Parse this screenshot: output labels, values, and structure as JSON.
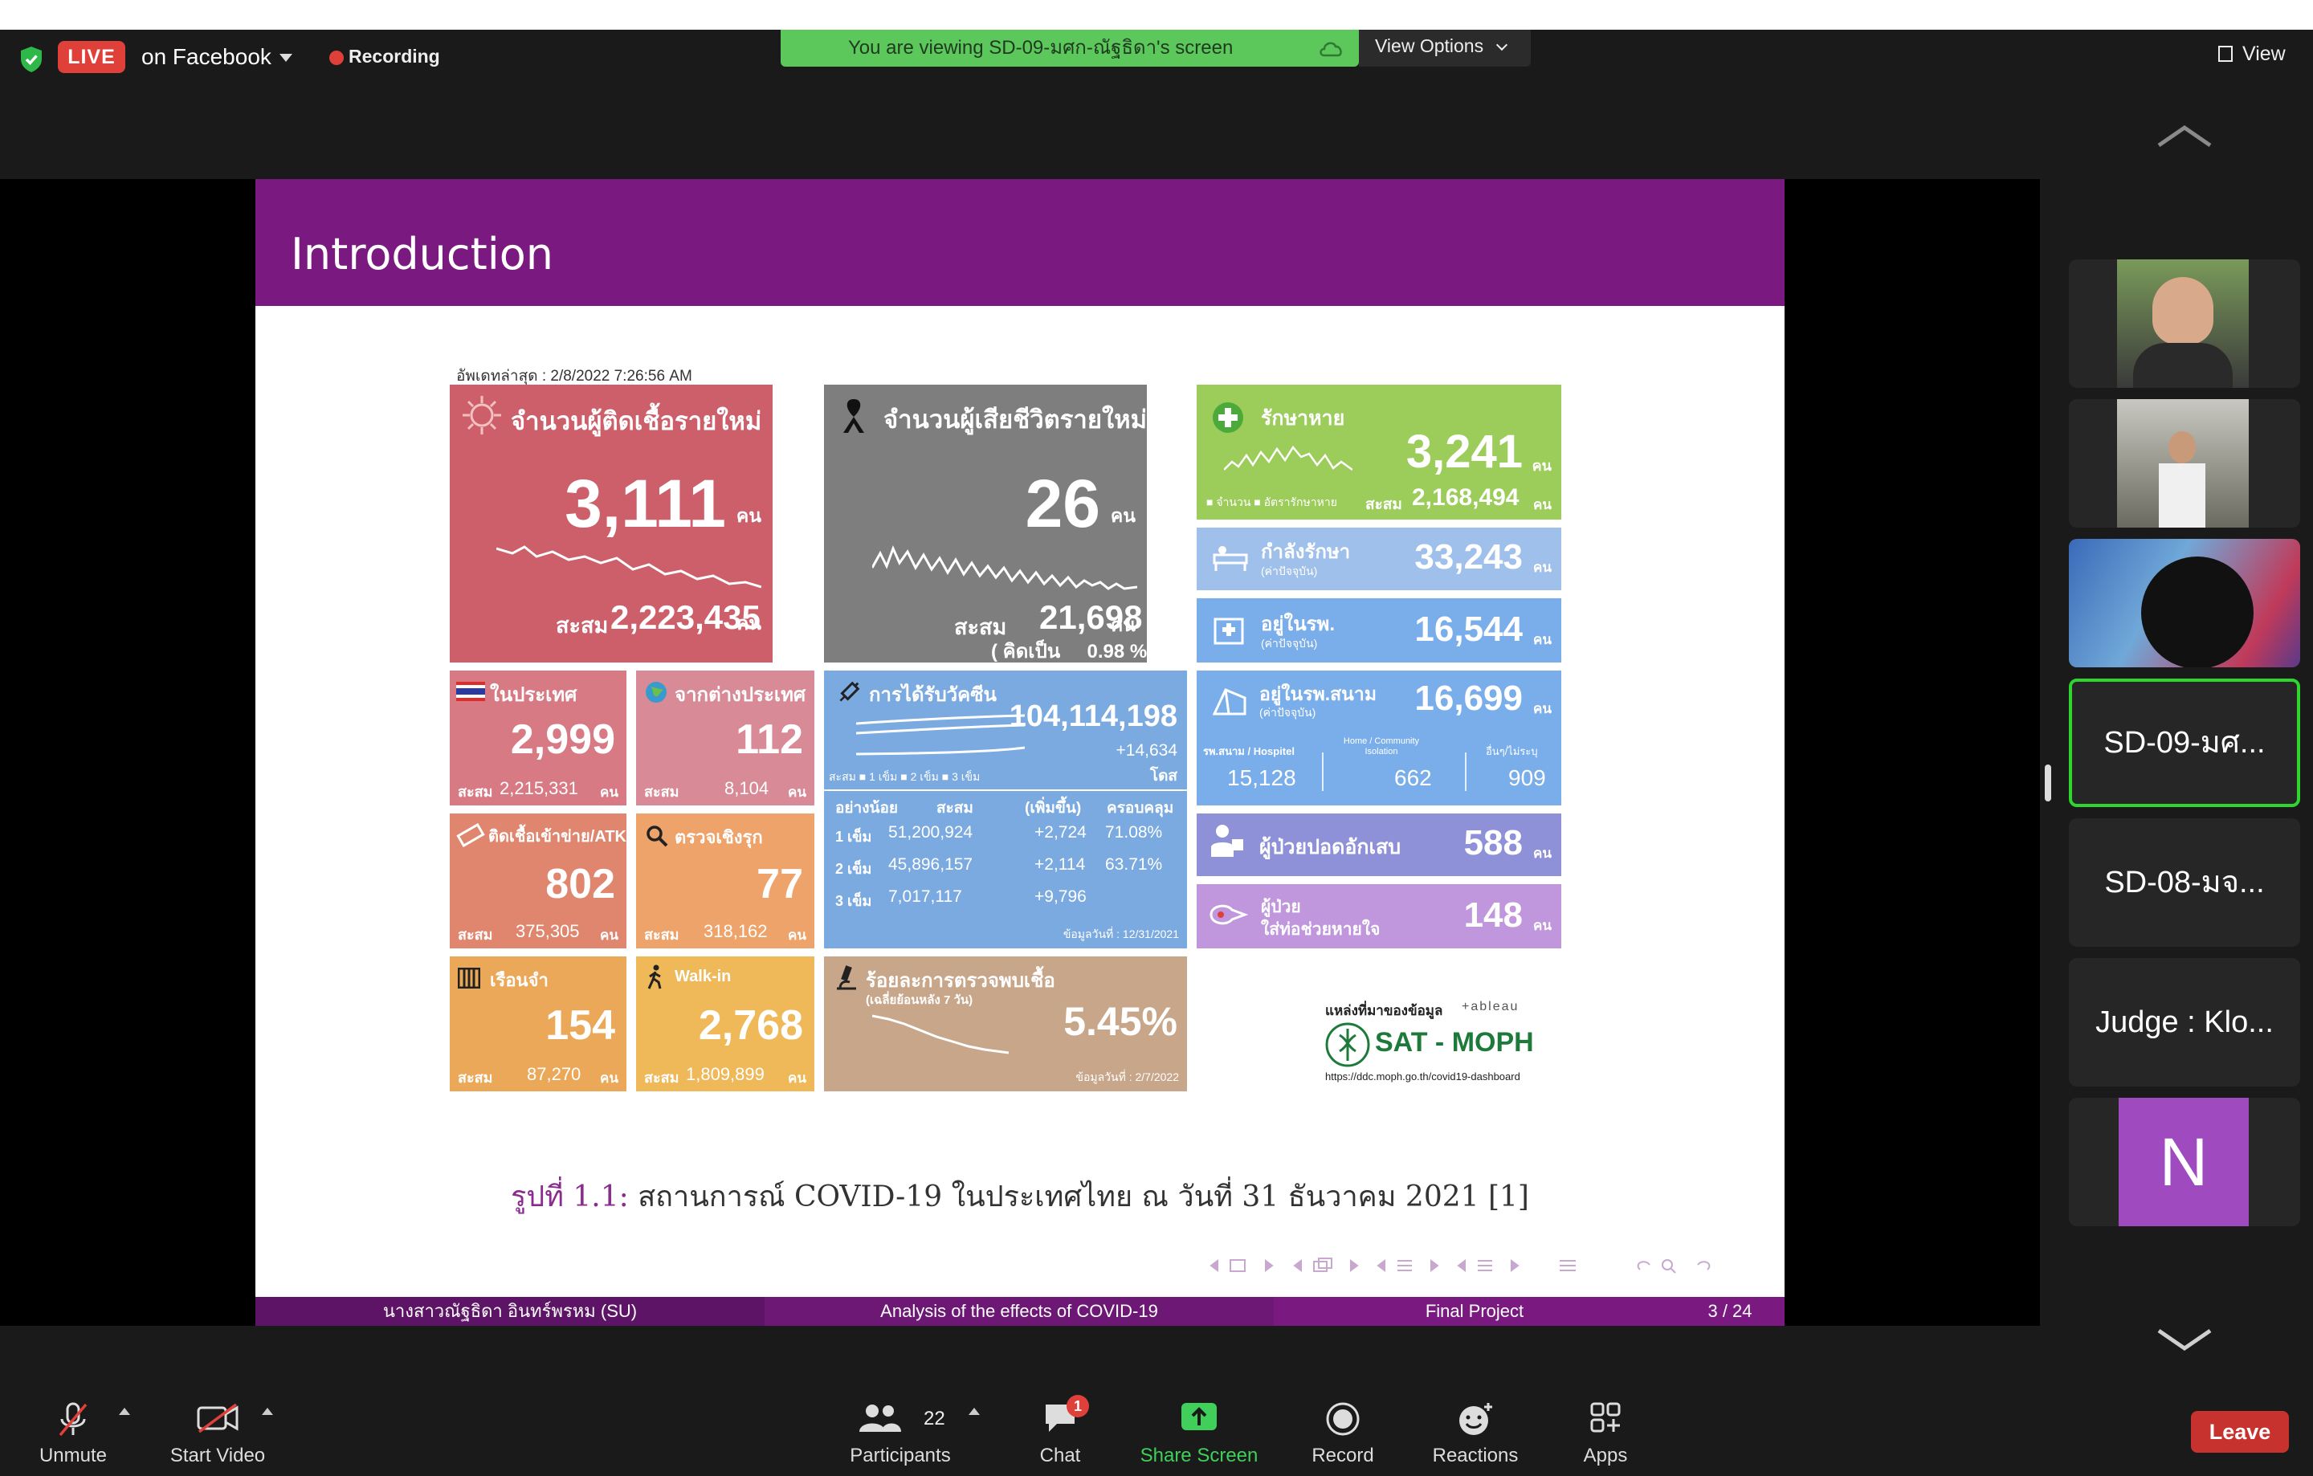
{
  "topbar": {
    "live_badge": "LIVE",
    "live_destination": "on Facebook",
    "recording": "Recording",
    "viewing_banner": "You are viewing SD-09-มศก-ณัฐธิดา's screen",
    "view_options": "View Options",
    "view": "View"
  },
  "slide": {
    "title": "Introduction",
    "caption_prefix": "รูปที่ 1.1:",
    "caption_text": " สถานการณ์ COVID-19 ในประเทศไทย ณ วันที่ 31 ธันวาคม 2021 [1]",
    "footer": {
      "author": "นางสาวณัฐธิดา อินทร์พรหม  (SU)",
      "topic": "Analysis of the effects of COVID-19",
      "project": "Final Project",
      "page": "3 / 24"
    }
  },
  "dashboard": {
    "updated": "อัพเดทล่าสุด : 2/8/2022 7:26:56 AM",
    "new_cases": {
      "label": "จำนวนผู้ติดเชื้อรายใหม่",
      "value": "3,111",
      "unit": "คน",
      "total_label": "สะสม",
      "total": "2,223,435",
      "total_unit": "คน"
    },
    "new_deaths": {
      "label": "จำนวนผู้เสียชีวิตรายใหม่",
      "value": "26",
      "unit": "คน",
      "total_label": "สะสม",
      "total": "21,698",
      "total_unit": "คน",
      "pct": "( คิดเป็น     0.98 % )"
    },
    "recovered": {
      "label": "รักษาหาย",
      "value": "3,241",
      "unit": "คน",
      "legend": "■ จำนวน ■ อัตรารักษาหาย",
      "total_label": "สะสม",
      "total": "2,168,494",
      "total_unit": "คน"
    },
    "treating": {
      "label": "กำลังรักษา",
      "sub": "(ค่าปัจจุบัน)",
      "value": "33,243",
      "unit": "คน"
    },
    "hospital": {
      "label": "อยู่ในรพ.",
      "sub": "(ค่าปัจจุบัน)",
      "value": "16,544",
      "unit": "คน"
    },
    "domestic": {
      "label": "ในประเทศ",
      "value": "2,999",
      "total_label": "สะสม",
      "total": "2,215,331",
      "unit": "คน"
    },
    "abroad": {
      "label": "จากต่างประเทศ",
      "value": "112",
      "total_label": "สะสม",
      "total": "8,104",
      "unit": "คน"
    },
    "atk": {
      "label": "ติดเชื้อเข้าข่าย/ATK",
      "value": "802",
      "total_label": "สะสม",
      "total": "375,305",
      "unit": "คน"
    },
    "proactive": {
      "label": "ตรวจเชิงรุก",
      "value": "77",
      "total_label": "สะสม",
      "total": "318,162",
      "unit": "คน"
    },
    "prison": {
      "label": "เรือนจำ",
      "value": "154",
      "total_label": "สะสม",
      "total": "87,270",
      "unit": "คน"
    },
    "walkin": {
      "label": "Walk-in",
      "value": "2,768",
      "total_label": "สะสม",
      "total": "1,809,899",
      "unit": "คน"
    },
    "vaccine": {
      "label": "การได้รับวัคซีน",
      "value": "104,114,198",
      "delta": "+14,634",
      "unit": "โดส",
      "legend": "สะสม ■ 1 เข็ม ■ 2 เข็ม ■ 3 เข็ม",
      "headers": [
        "อย่างน้อย",
        "สะสม",
        "(เพิ่มขึ้น)",
        "ครอบคลุม"
      ],
      "rows": [
        [
          "1 เข็ม",
          "51,200,924",
          "+2,724",
          "71.08%"
        ],
        [
          "2 เข็ม",
          "45,896,157",
          "+2,114",
          "63.71%"
        ],
        [
          "3 เข็ม",
          "7,017,117",
          "+9,796",
          ""
        ]
      ],
      "asof": "ข้อมูลวันที่ : 12/31/2021"
    },
    "field_hosp": {
      "label": "อยู่ในรพ.สนาม",
      "sub": "(ค่าปัจจุบัน)",
      "value": "16,699",
      "unit": "คน",
      "cols": [
        "รพ.สนาม / Hospitel",
        "Home / Community Isolation",
        "อื่นๆ/ไม่ระบุ"
      ],
      "vals": [
        "15,128",
        "662",
        "909"
      ]
    },
    "pneumonia": {
      "label": "ผู้ป่วยปอดอักเสบ",
      "value": "588",
      "unit": "คน"
    },
    "ventilator": {
      "label1": "ผู้ป่วย",
      "label2": "ใส่ท่อช่วยหายใจ",
      "value": "148",
      "unit": "คน"
    },
    "positivity": {
      "label": "ร้อยละการตรวจพบเชื้อ",
      "sub": "(เฉลี่ยย้อนหลัง 7 วัน)",
      "value": "5.45%",
      "asof": "ข้อมูลวันที่ : 2/7/2022"
    },
    "source": {
      "heading": "แหล่งที่มาของข้อมูล",
      "tableau": "+ableau",
      "org": "SAT - MOPH",
      "url": "https://ddc.moph.go.th/covid19-dashboard"
    }
  },
  "gallery": [
    {
      "name": "",
      "type": "photo",
      "color": "#6a8a5a"
    },
    {
      "name": "",
      "type": "photo",
      "color": "#8a8a80"
    },
    {
      "name": "",
      "type": "photo",
      "color": "#4a7aa8"
    },
    {
      "name": "SD-09-มศ...",
      "type": "name"
    },
    {
      "name": "SD-08-มจ...",
      "type": "name"
    },
    {
      "name": "Judge : Klo...",
      "type": "name"
    },
    {
      "name": "N",
      "type": "avatar",
      "color": "#a04ac0"
    }
  ],
  "toolbar": {
    "unmute": "Unmute",
    "start_video": "Start Video",
    "participants": "Participants",
    "participants_count": "22",
    "chat": "Chat",
    "chat_badge": "1",
    "share_screen": "Share Screen",
    "record": "Record",
    "reactions": "Reactions",
    "apps": "Apps",
    "leave": "Leave"
  },
  "colors": {
    "live": "#e0403a",
    "banner": "#5cc85c",
    "slide_header": "#7a1a80",
    "share_green": "#3fcf5a",
    "leave": "#c8322e"
  }
}
